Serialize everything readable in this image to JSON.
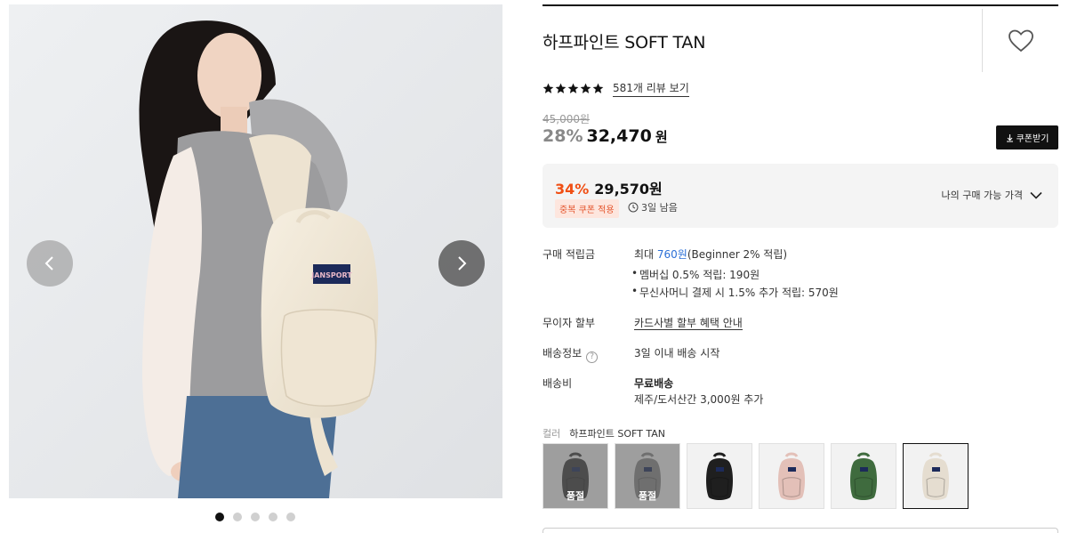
{
  "product": {
    "title": "하프파인트 SOFT TAN",
    "rating": 5,
    "review_link": "581개 리뷰 보기"
  },
  "price": {
    "original": "45,000원",
    "discount": "28%",
    "amount": "32,470",
    "unit": "원",
    "coupon_button": "쿠폰받기"
  },
  "best_price": {
    "discount": "34%",
    "amount": "29,570원",
    "badge": "중복 쿠폰 적용",
    "remaining": "3일 남음",
    "my_price_label": "나의 구매 가능 가격"
  },
  "details": {
    "points": {
      "label": "구매 적립금",
      "value_prefix": "최대 ",
      "value_amount": "760원",
      "value_suffix": "(Beginner 2% 적립)",
      "bullets": [
        "멤버십 0.5% 적립: 190원",
        "무신사머니 결제 시 1.5% 추가 적립: 570원"
      ]
    },
    "installment": {
      "label": "무이자 할부",
      "value": "카드사별 할부 혜택 안내"
    },
    "shipping_info": {
      "label": "배송정보",
      "help": "?",
      "value": "3일 이내 배송 시작"
    },
    "shipping_fee": {
      "label": "배송비",
      "value": "무료배송",
      "note": "제주/도서산간 3,000원 추가"
    }
  },
  "color": {
    "label": "컬러",
    "selected": "하프파인트 SOFT TAN",
    "soldout_label": "품절",
    "swatches": [
      {
        "name": "charcoal",
        "color": "#3c3c3c",
        "soldout": true
      },
      {
        "name": "grey",
        "color": "#8a8a8a",
        "soldout": true
      },
      {
        "name": "black",
        "color": "#1f1f1f",
        "soldout": false
      },
      {
        "name": "pink",
        "color": "#e3c0b8",
        "soldout": false
      },
      {
        "name": "green",
        "color": "#3f6b3e",
        "soldout": false
      },
      {
        "name": "soft-tan",
        "color": "#e5ddd0",
        "soldout": false
      }
    ]
  },
  "gallery": {
    "slide_count": 5,
    "active_slide": 1,
    "brand_patch": "JANSPORT"
  },
  "colors": {
    "accent_orange": "#f04f14",
    "link_blue": "#2b6fd6",
    "dark": "#111111"
  }
}
